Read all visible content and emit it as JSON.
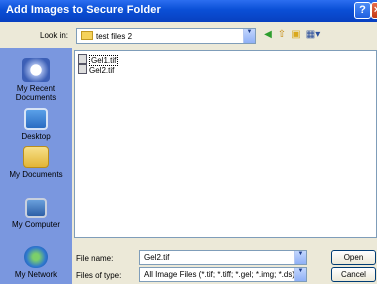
{
  "window": {
    "title": "Add Images to Secure Folder"
  },
  "look_in": {
    "label": "Look in:",
    "value": "test files 2"
  },
  "places": [
    {
      "label": "My Recent Documents",
      "icon": "recent-documents-icon"
    },
    {
      "label": "Desktop",
      "icon": "desktop-icon"
    },
    {
      "label": "My Documents",
      "icon": "my-documents-icon"
    },
    {
      "label": "My Computer",
      "icon": "my-computer-icon"
    },
    {
      "label": "My Network",
      "icon": "my-network-icon"
    }
  ],
  "files": [
    {
      "name": "Gel1.tif"
    },
    {
      "name": "Gel2.tif"
    }
  ],
  "file_name": {
    "label": "File name:",
    "value": "Gel2.tif"
  },
  "file_type": {
    "label": "Files of type:",
    "value": "All Image Files (*.tif; *.tiff; *.gel; *.img; *.ds)"
  },
  "buttons": {
    "open": "Open",
    "cancel": "Cancel"
  }
}
